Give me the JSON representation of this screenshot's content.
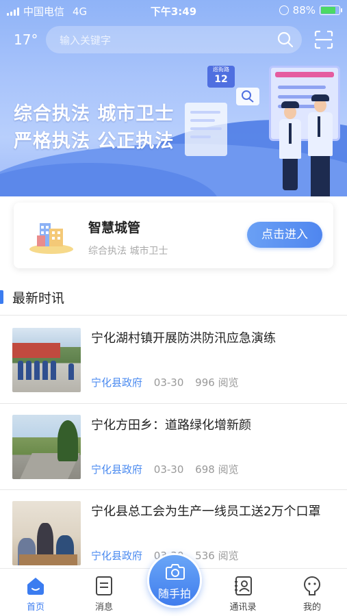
{
  "status_bar": {
    "carrier": "中国电信",
    "network": "4G",
    "time": "下午3:49",
    "battery": "88%",
    "battery_level": 0.88
  },
  "header": {
    "temperature": "17°",
    "search_placeholder": "输入关键字",
    "icons": [
      "search-icon",
      "scan-icon"
    ]
  },
  "banner": {
    "line1": "综合执法 城市卫士",
    "line2": "严格执法 公正执法",
    "sign_label": "巡街路",
    "sign_number": "12"
  },
  "feature_card": {
    "title": "智慧城管",
    "subtitle": "综合执法 城市卫士",
    "button_label": "点击进入"
  },
  "news_section": {
    "title": "最新时讯",
    "items": [
      {
        "title": "宁化湖村镇开展防洪防汛应急演练",
        "source": "宁化县政府",
        "date": "03-30",
        "views": "996 阅览"
      },
      {
        "title": "宁化方田乡：道路绿化增新颜",
        "source": "宁化县政府",
        "date": "03-30",
        "views": "698 阅览"
      },
      {
        "title": "宁化县总工会为生产一线员工送2万个口罩",
        "source": "宁化县政府",
        "date": "03-30",
        "views": "536 阅览"
      }
    ]
  },
  "tab_bar": {
    "tabs": [
      {
        "label": "首页",
        "icon": "home-icon",
        "active": true
      },
      {
        "label": "消息",
        "icon": "message-icon",
        "active": false
      },
      {
        "label": "通讯录",
        "icon": "contacts-icon",
        "active": false
      },
      {
        "label": "我的",
        "icon": "profile-icon",
        "active": false
      }
    ],
    "center_button": {
      "label": "随手拍",
      "icon": "camera-icon"
    }
  },
  "colors": {
    "accent": "#3b7cf0",
    "source_link": "#4a8af0",
    "banner_sky": "#a9c4fb"
  }
}
